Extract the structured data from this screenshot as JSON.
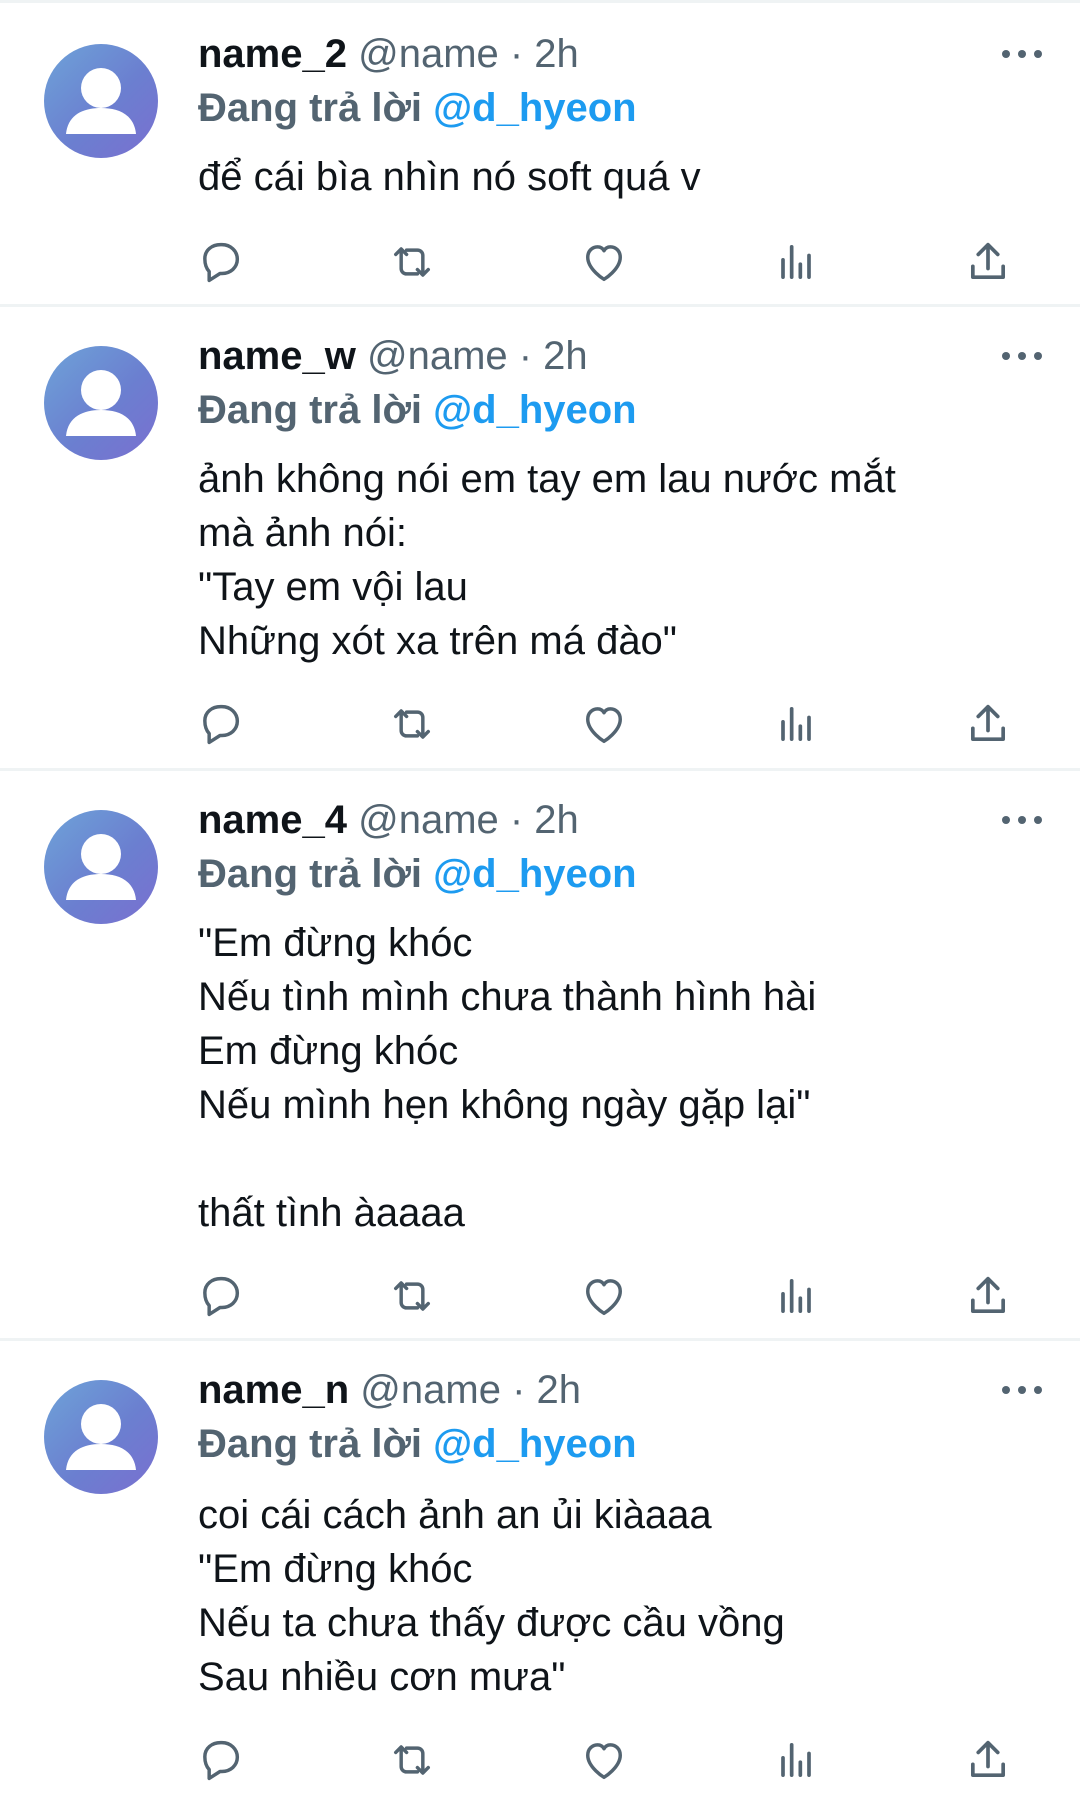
{
  "tweets": [
    {
      "display_name": "name_2",
      "handle_time": " @name · 2h",
      "reply_prefix": "Đang trả lời ",
      "reply_mention": "@d_hyeon",
      "lines": [
        "để cái bìa nhìn nó soft quá v"
      ]
    },
    {
      "display_name": "name_w",
      "handle_time": " @name · 2h",
      "reply_prefix": "Đang trả lời ",
      "reply_mention": "@d_hyeon",
      "lines": [
        "ảnh không nói em tay em lau nước mắt",
        "mà ảnh nói:",
        "\"Tay em vội lau",
        "Những xót xa trên má đào\""
      ]
    },
    {
      "display_name": "name_4",
      "handle_time": " @name · 2h",
      "reply_prefix": "Đang trả lời ",
      "reply_mention": "@d_hyeon",
      "lines": [
        "\"Em đừng khóc",
        "Nếu tình mình chưa thành hình hài",
        "Em đừng khóc",
        "Nếu mình hẹn không ngày gặp lại\"",
        "",
        "thất tình àaaaa"
      ]
    },
    {
      "display_name": "name_n",
      "handle_time": " @name · 2h",
      "reply_prefix": "Đang trả lời ",
      "reply_mention": "@d_hyeon",
      "lines": [
        "coi cái cách ảnh an ủi kiàaaa",
        "\"Em đừng khóc",
        "Nếu ta chưa thấy được cầu vồng",
        "Sau nhiều cơn mưa\""
      ]
    }
  ],
  "icons": {
    "avatar": "default-avatar-icon",
    "more": "more-options-icon",
    "reply": "reply-icon",
    "retweet": "retweet-icon",
    "like": "like-icon",
    "views": "views-icon",
    "share": "share-icon"
  },
  "colors": {
    "accent": "#1d9bf0",
    "secondary_text": "#536471",
    "primary_text": "#0f1419",
    "divider": "#eff3f4"
  }
}
